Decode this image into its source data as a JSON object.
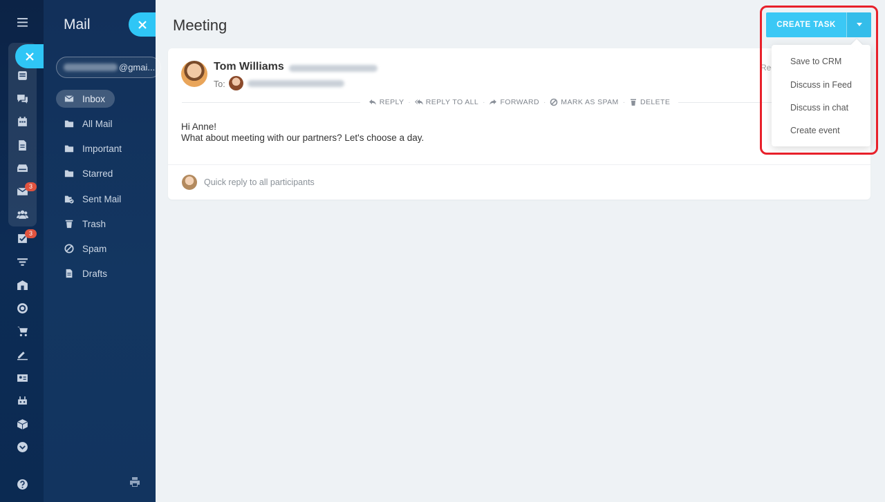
{
  "rail": {
    "badges": {
      "mail": "3",
      "tasks": "3"
    }
  },
  "sidebar": {
    "title": "Mail",
    "account_suffix": "@gmai...",
    "folders": [
      {
        "label": "Inbox",
        "icon": "envelope-icon"
      },
      {
        "label": "All Mail",
        "icon": "folder-icon"
      },
      {
        "label": "Important",
        "icon": "folder-icon"
      },
      {
        "label": "Starred",
        "icon": "folder-icon"
      },
      {
        "label": "Sent Mail",
        "icon": "sent-mail-icon"
      },
      {
        "label": "Trash",
        "icon": "trash-icon"
      },
      {
        "label": "Spam",
        "icon": "block-icon"
      },
      {
        "label": "Drafts",
        "icon": "document-icon"
      }
    ]
  },
  "page": {
    "title": "Meeting"
  },
  "message": {
    "sender_name": "Tom Williams",
    "to_label": "To:",
    "right_partial": "Rec",
    "actions": {
      "reply": "REPLY",
      "reply_all": "REPLY TO ALL",
      "forward": "FORWARD",
      "spam": "MARK AS SPAM",
      "delete": "DELETE"
    },
    "body_line1": "Hi Anne!",
    "body_line2": "What about meeting with our partners? Let's choose a day.",
    "quick_reply": "Quick reply to all participants"
  },
  "create_task": {
    "label": "CREATE TASK",
    "menu": [
      "Save to CRM",
      "Discuss in Feed",
      "Discuss in chat",
      "Create event"
    ]
  },
  "colors": {
    "accent": "#3bc8f5",
    "highlight": "#e8202a",
    "sidebar": "#12305a",
    "badge": "#e0533f"
  }
}
